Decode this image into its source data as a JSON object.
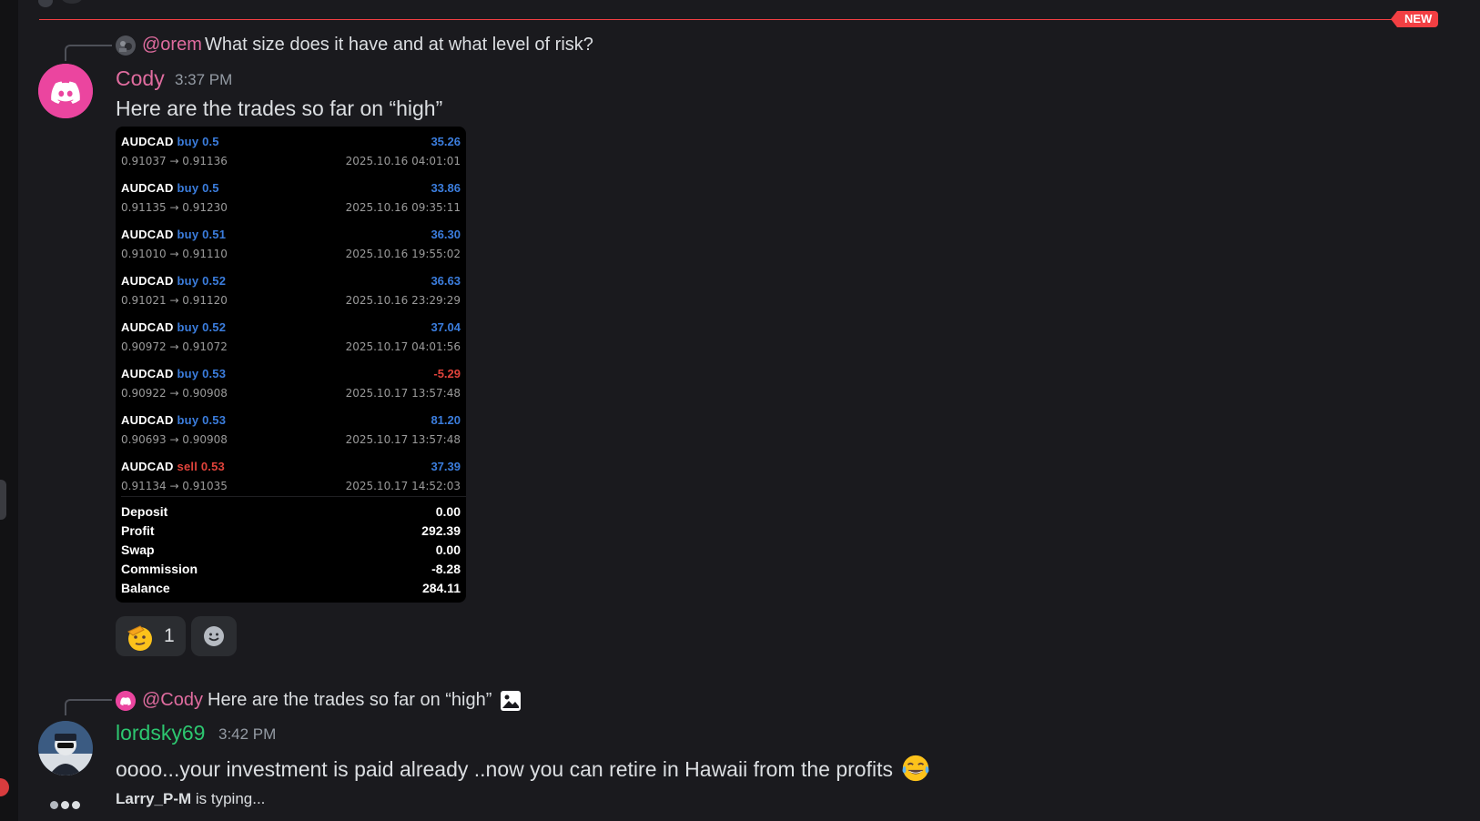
{
  "new_divider": {
    "label": "NEW"
  },
  "message1": {
    "reply": {
      "mention": "@orem",
      "text": "What size does it have and at what level of risk?"
    },
    "author": "Cody",
    "author_color": "#e06c9f",
    "timestamp": "3:37 PM",
    "text": "Here are the trades so far on “high”",
    "trades": [
      {
        "symbol": "AUDCAD",
        "direction": "buy",
        "volume": "0.5",
        "prices": "0.91037 → 0.91136",
        "profit": "35.26",
        "time": "2025.10.16 04:01:01"
      },
      {
        "symbol": "AUDCAD",
        "direction": "buy",
        "volume": "0.5",
        "prices": "0.91135 → 0.91230",
        "profit": "33.86",
        "time": "2025.10.16 09:35:11"
      },
      {
        "symbol": "AUDCAD",
        "direction": "buy",
        "volume": "0.51",
        "prices": "0.91010 → 0.91110",
        "profit": "36.30",
        "time": "2025.10.16 19:55:02"
      },
      {
        "symbol": "AUDCAD",
        "direction": "buy",
        "volume": "0.52",
        "prices": "0.91021 → 0.91120",
        "profit": "36.63",
        "time": "2025.10.16 23:29:29"
      },
      {
        "symbol": "AUDCAD",
        "direction": "buy",
        "volume": "0.52",
        "prices": "0.90972 → 0.91072",
        "profit": "37.04",
        "time": "2025.10.17 04:01:56"
      },
      {
        "symbol": "AUDCAD",
        "direction": "buy",
        "volume": "0.53",
        "prices": "0.90922 → 0.90908",
        "profit": "-5.29",
        "time": "2025.10.17 13:57:48"
      },
      {
        "symbol": "AUDCAD",
        "direction": "buy",
        "volume": "0.53",
        "prices": "0.90693 → 0.90908",
        "profit": "81.20",
        "time": "2025.10.17 13:57:48"
      },
      {
        "symbol": "AUDCAD",
        "direction": "sell",
        "volume": "0.53",
        "prices": "0.91134 → 0.91035",
        "profit": "37.39",
        "time": "2025.10.17 14:52:03"
      }
    ],
    "summary": [
      {
        "label": "Deposit",
        "value": "0.00"
      },
      {
        "label": "Profit",
        "value": "292.39"
      },
      {
        "label": "Swap",
        "value": "0.00"
      },
      {
        "label": "Commission",
        "value": "-8.28"
      },
      {
        "label": "Balance",
        "value": "284.11"
      }
    ],
    "reactions": [
      {
        "emoji": "saluting-face",
        "count": "1"
      },
      {
        "emoji": "add-reaction"
      }
    ]
  },
  "message2": {
    "reply": {
      "mention": "@Cody",
      "text": "Here are the trades so far on “high”",
      "attachment_icon": "image-icon"
    },
    "author": "lordsky69",
    "author_color": "#2dc770",
    "timestamp": "3:42 PM",
    "text": "oooo...your investment is paid already ..now  you can retire in Hawaii from the profits",
    "emoji": "tears-of-joy"
  },
  "typing": {
    "user": "Larry_P-M",
    "suffix": "is typing..."
  }
}
